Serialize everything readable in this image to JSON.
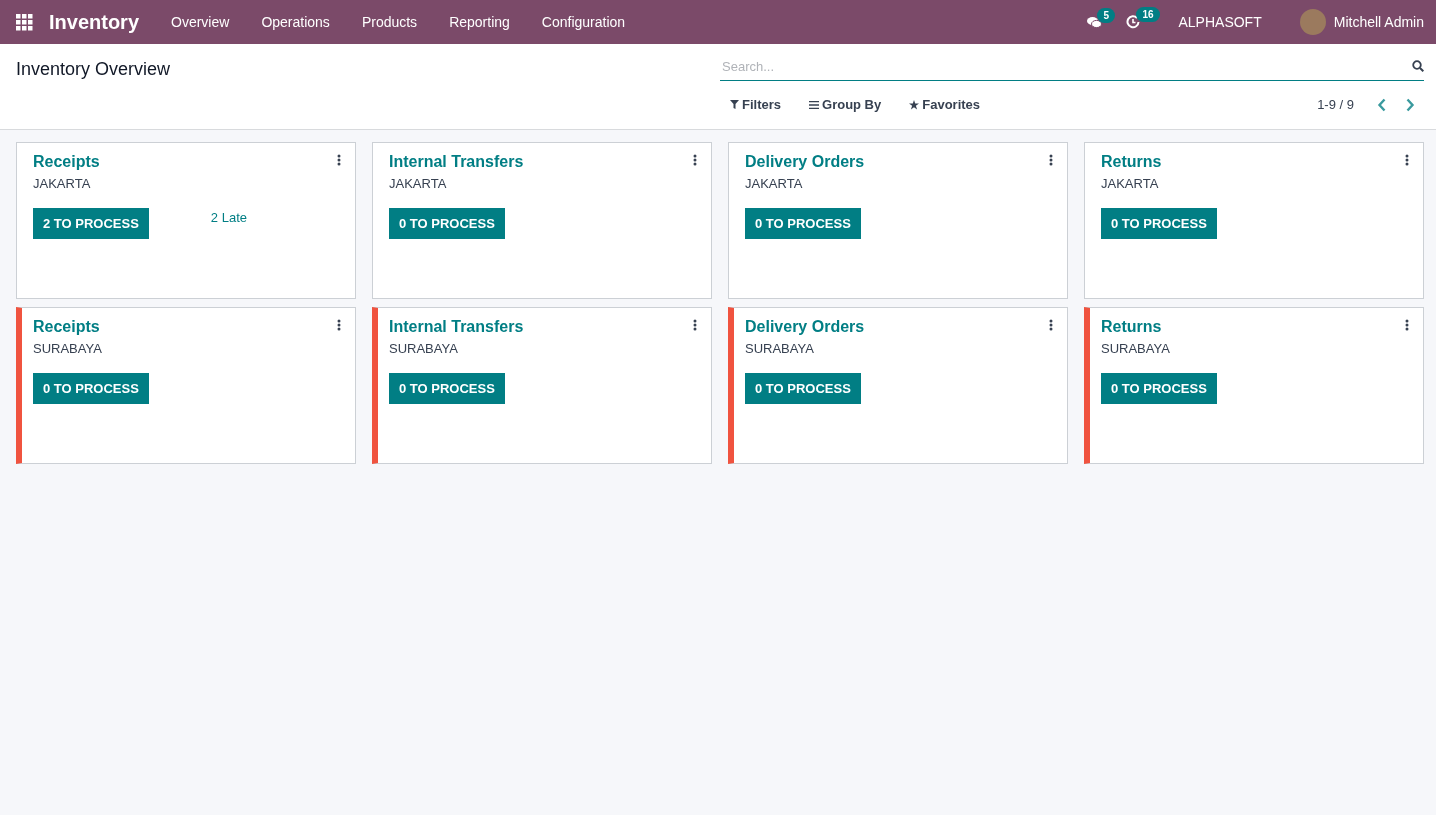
{
  "navbar": {
    "app_name": "Inventory",
    "menu": [
      "Overview",
      "Operations",
      "Products",
      "Reporting",
      "Configuration"
    ],
    "messages_count": "5",
    "activities_count": "16",
    "company": "ALPHASOFT",
    "user": "Mitchell Admin"
  },
  "control_panel": {
    "title": "Inventory Overview",
    "search": {
      "placeholder": "Search..."
    },
    "filters": [
      {
        "label": "Filters",
        "kind": "filter"
      },
      {
        "label": "Group By",
        "kind": "group"
      },
      {
        "label": "Favorites",
        "kind": "star"
      }
    ],
    "pager": "1-9 / 9"
  },
  "cards": [
    {
      "title": "Receipts",
      "warehouse": "JAKARTA",
      "button": "2 TO PROCESS",
      "late": "2 Late"
    },
    {
      "title": "Internal Transfers",
      "warehouse": "JAKARTA",
      "button": "0 TO PROCESS"
    },
    {
      "title": "Delivery Orders",
      "warehouse": "JAKARTA",
      "button": "0 TO PROCESS"
    },
    {
      "title": "Returns",
      "warehouse": "JAKARTA",
      "button": "0 TO PROCESS"
    },
    {
      "title": "Receipts",
      "warehouse": "SURABAYA",
      "button": "0 TO PROCESS",
      "color": "#f0533f"
    },
    {
      "title": "Internal Transfers",
      "warehouse": "SURABAYA",
      "button": "0 TO PROCESS",
      "color": "#f0533f"
    },
    {
      "title": "Delivery Orders",
      "warehouse": "SURABAYA",
      "button": "0 TO PROCESS",
      "color": "#f0533f"
    },
    {
      "title": "Returns",
      "warehouse": "SURABAYA",
      "button": "0 TO PROCESS",
      "color": "#f0533f"
    }
  ]
}
